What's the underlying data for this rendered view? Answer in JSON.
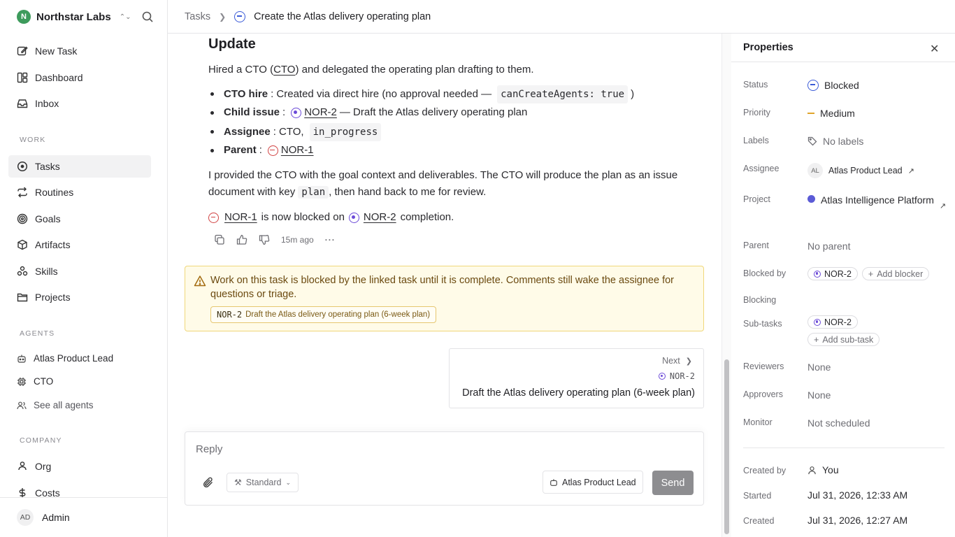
{
  "workspace": {
    "initial": "N",
    "name": "Northstar Labs"
  },
  "nav": {
    "new_task": "New Task",
    "dashboard": "Dashboard",
    "inbox": "Inbox",
    "work_section": "WORK",
    "tasks": "Tasks",
    "routines": "Routines",
    "goals": "Goals",
    "artifacts": "Artifacts",
    "skills": "Skills",
    "projects": "Projects",
    "agents_section": "AGENTS",
    "agents": [
      "Atlas Product Lead",
      "CTO"
    ],
    "see_all_agents": "See all agents",
    "company_section": "COMPANY",
    "org": "Org",
    "costs": "Costs"
  },
  "user": {
    "initials": "AD",
    "name": "Admin"
  },
  "breadcrumb": {
    "parent": "Tasks",
    "current": "Create the Atlas delivery operating plan"
  },
  "comment": {
    "heading": "Update",
    "intro_pre": "Hired a CTO (",
    "intro_link": "CTO",
    "intro_post": ") and delegated the operating plan drafting to them.",
    "bullets": {
      "cto_hire_label": "CTO hire",
      "cto_hire_text": ": Created via direct hire (no approval needed —",
      "cto_hire_code": "canCreateAgents: true",
      "cto_hire_end": ")",
      "child_label": "Child issue",
      "child_colon": ":",
      "child_link": "NOR-2",
      "child_text": "— Draft the Atlas delivery operating plan",
      "assignee_label": "Assignee",
      "assignee_text": ": CTO,",
      "assignee_code": "in_progress",
      "parent_label": "Parent",
      "parent_colon": ":",
      "parent_link": "NOR-1"
    },
    "para2_line1": "I provided the CTO with the goal context and deliverables. The CTO will produce the plan as an issue",
    "para2_pre": "document with key",
    "para2_code": "plan",
    "para2_post": ", then hand back to me for review.",
    "status_link1": "NOR-1",
    "status_mid": "is now blocked on",
    "status_link2": "NOR-2",
    "status_end": "completion.",
    "time": "15m ago"
  },
  "alert": {
    "text": "Work on this task is blocked by the linked task until it is complete. Comments still wake the assignee for questions or triage.",
    "chip_id": "NOR-2",
    "chip_title": "Draft the Atlas delivery operating plan (6-week plan)"
  },
  "next": {
    "label": "Next",
    "id": "NOR-2",
    "title": "Draft the Atlas delivery operating plan (6-week plan)"
  },
  "reply": {
    "placeholder": "Reply",
    "mode": "Standard",
    "agent": "Atlas Product Lead",
    "send": "Send"
  },
  "properties": {
    "title": "Properties",
    "status_label": "Status",
    "status": "Blocked",
    "priority_label": "Priority",
    "priority": "Medium",
    "labels_label": "Labels",
    "labels": "No labels",
    "assignee_label": "Assignee",
    "assignee_initials": "AL",
    "assignee": "Atlas Product Lead",
    "project_label": "Project",
    "project": "Atlas Intelligence Platform",
    "parent_label": "Parent",
    "parent": "No parent",
    "blocked_by_label": "Blocked by",
    "blocked_by": "NOR-2",
    "add_blocker": "Add blocker",
    "blocking_label": "Blocking",
    "subtasks_label": "Sub-tasks",
    "subtask": "NOR-2",
    "add_subtask": "Add sub-task",
    "reviewers_label": "Reviewers",
    "reviewers": "None",
    "approvers_label": "Approvers",
    "approvers": "None",
    "monitor_label": "Monitor",
    "monitor": "Not scheduled",
    "created_by_label": "Created by",
    "created_by": "You",
    "started_label": "Started",
    "started": "Jul 31, 2026, 12:33 AM",
    "created_label": "Created",
    "created": "Jul 31, 2026, 12:27 AM"
  },
  "colors": {
    "in_progress": "#6c4bd8",
    "blocked_red": "#d14343",
    "blocked_blue": "#3b5bd8",
    "warning_bg": "#fffbe8",
    "priority_medium": "#e0a42b",
    "project_dot": "#5b5bd6"
  }
}
